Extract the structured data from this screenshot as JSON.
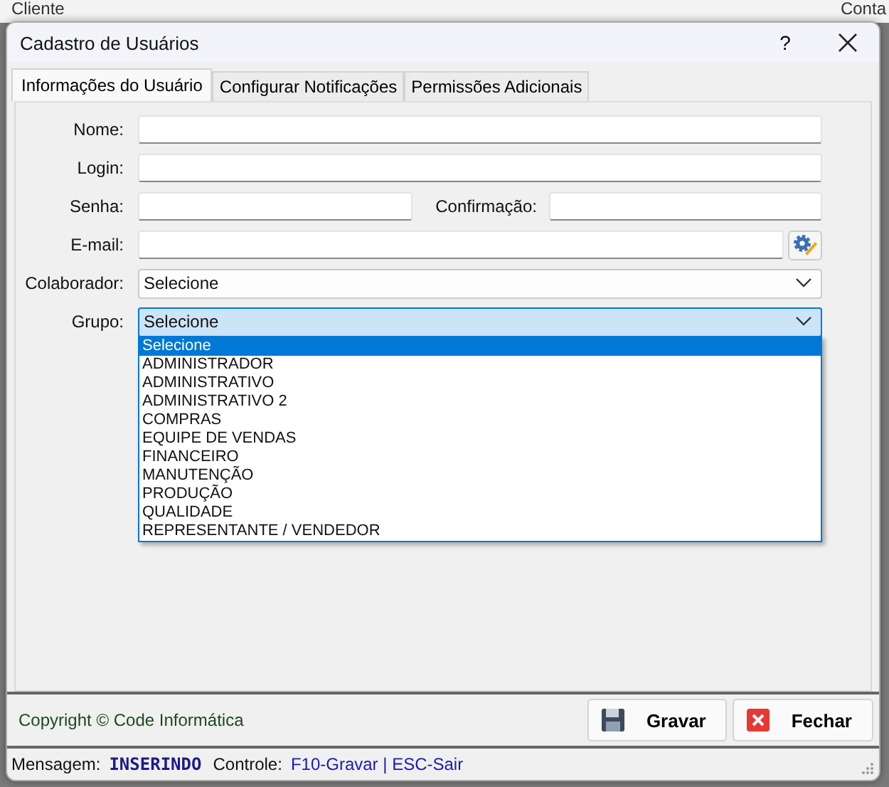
{
  "background_window": {
    "labels": [
      "Cliente",
      "Conta"
    ]
  },
  "window": {
    "title": "Cadastro de Usuários",
    "help": "?"
  },
  "tabs": [
    {
      "label": "Informações do Usuário",
      "selected": true
    },
    {
      "label": "Configurar Notificações",
      "selected": false
    },
    {
      "label": "Permissões Adicionais",
      "selected": false
    }
  ],
  "form": {
    "nome": {
      "label": "Nome:"
    },
    "login": {
      "label": "Login:"
    },
    "senha": {
      "label": "Senha:"
    },
    "confirmacao": {
      "label": "Confirmação:"
    },
    "email": {
      "label": "E-mail:"
    },
    "colaborador": {
      "label": "Colaborador:",
      "value": "Selecione",
      "focused": false
    },
    "grupo": {
      "label": "Grupo:",
      "value": "Selecione",
      "focused": true,
      "expanded": true,
      "options": [
        {
          "label": "Selecione",
          "selected": true
        },
        {
          "label": "ADMINISTRADOR",
          "selected": false
        },
        {
          "label": "ADMINISTRATIVO",
          "selected": false
        },
        {
          "label": "ADMINISTRATIVO 2",
          "selected": false
        },
        {
          "label": "COMPRAS",
          "selected": false
        },
        {
          "label": "EQUIPE DE VENDAS",
          "selected": false
        },
        {
          "label": "FINANCEIRO",
          "selected": false
        },
        {
          "label": "MANUTENÇÃO",
          "selected": false
        },
        {
          "label": "PRODUÇÃO",
          "selected": false
        },
        {
          "label": "QUALIDADE",
          "selected": false
        },
        {
          "label": "REPRESENTANTE / VENDEDOR",
          "selected": false
        }
      ]
    }
  },
  "footer": {
    "copyright": "Copyright © Code Informática",
    "buttons": [
      {
        "label": "Gravar",
        "kind": "save"
      },
      {
        "label": "Fechar",
        "kind": "close"
      }
    ]
  },
  "status_bar": {
    "message_label": "Mensagem:",
    "message": "INSERINDO",
    "control_label": "Controle:",
    "control": "F10-Gravar | ESC-Sair"
  }
}
